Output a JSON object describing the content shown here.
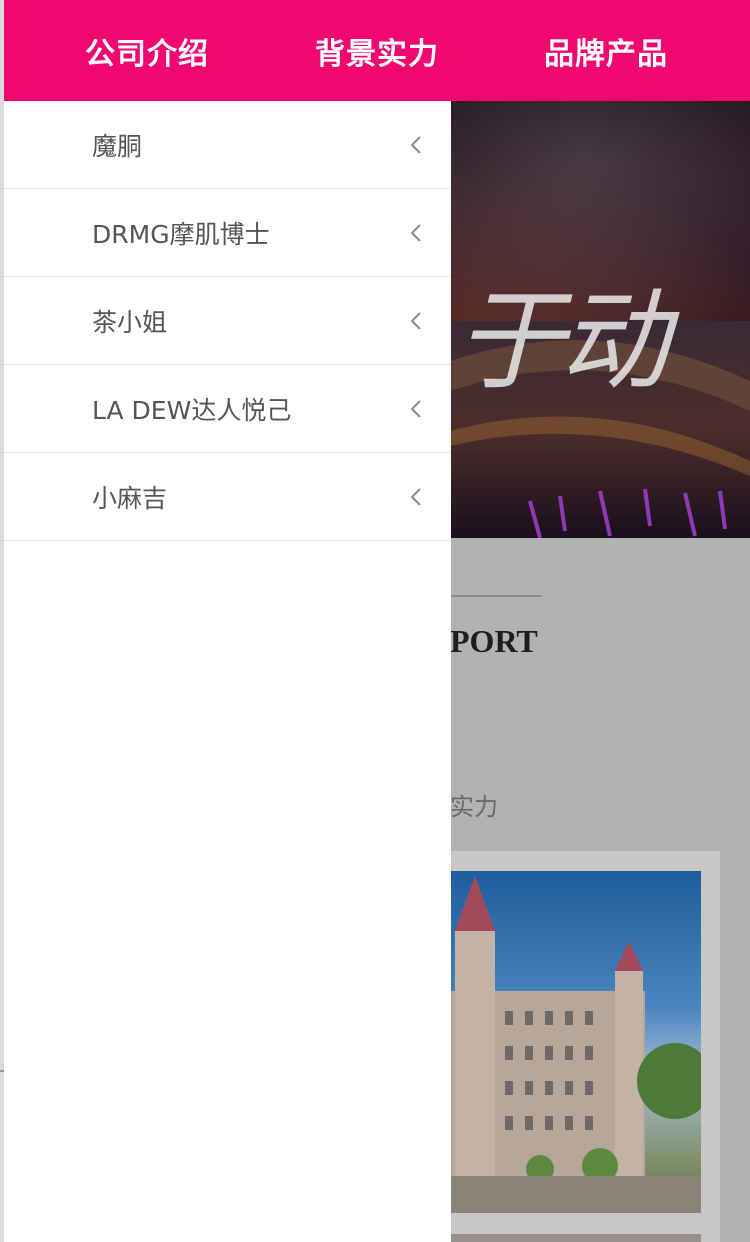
{
  "top_nav": {
    "items": [
      {
        "label": "公司介绍"
      },
      {
        "label": "背景实力"
      },
      {
        "label": "品牌产品"
      }
    ],
    "background_color": "#f0076f"
  },
  "drawer": {
    "items": [
      {
        "label": "魔胴",
        "icon": "chevron-left-icon"
      },
      {
        "label": "DRMG摩肌博士",
        "icon": "chevron-left-icon"
      },
      {
        "label": "茶小姐",
        "icon": "chevron-left-icon"
      },
      {
        "label": "LA DEW达人悦己",
        "icon": "chevron-left-icon"
      },
      {
        "label": "小麻吉",
        "icon": "chevron-left-icon"
      }
    ]
  },
  "background_page": {
    "hero_slogan": "于动",
    "section_title": "PORT",
    "section_subtitle": "实力"
  }
}
